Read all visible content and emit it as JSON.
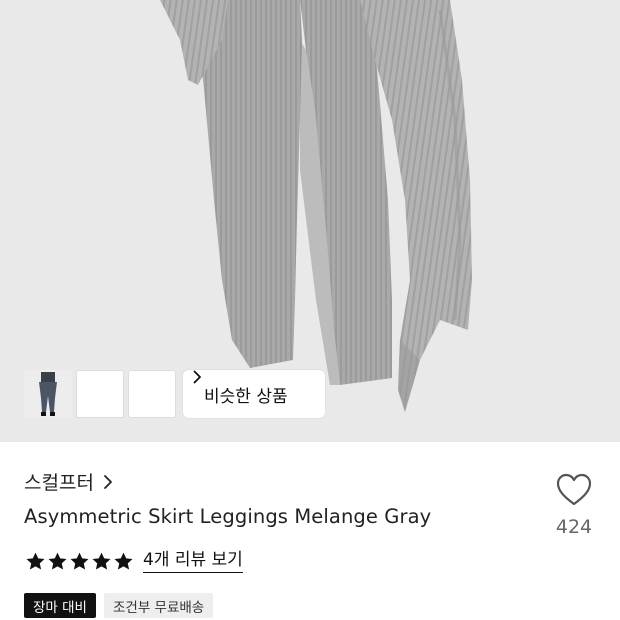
{
  "colors": {
    "hero_background": "#e9e9e9",
    "fabric": "#a7a7a7",
    "star": "#111111",
    "badge_dark": "#111111",
    "badge_light": "#eeeeee"
  },
  "gallery": {
    "thumbnail_count": 3,
    "similar_button_label": "비슷한 상품"
  },
  "product": {
    "brand": "스컬프터",
    "title": "Asymmetric Skirt Leggings Melange Gray",
    "like_count": "424",
    "like_icon": "heart-outline-icon",
    "rating_stars": 5,
    "review_link": "4개 리뷰 보기"
  },
  "badges": [
    {
      "label": "장마 대비",
      "style": "dark"
    },
    {
      "label": "조건부 무료배송",
      "style": "light"
    }
  ]
}
